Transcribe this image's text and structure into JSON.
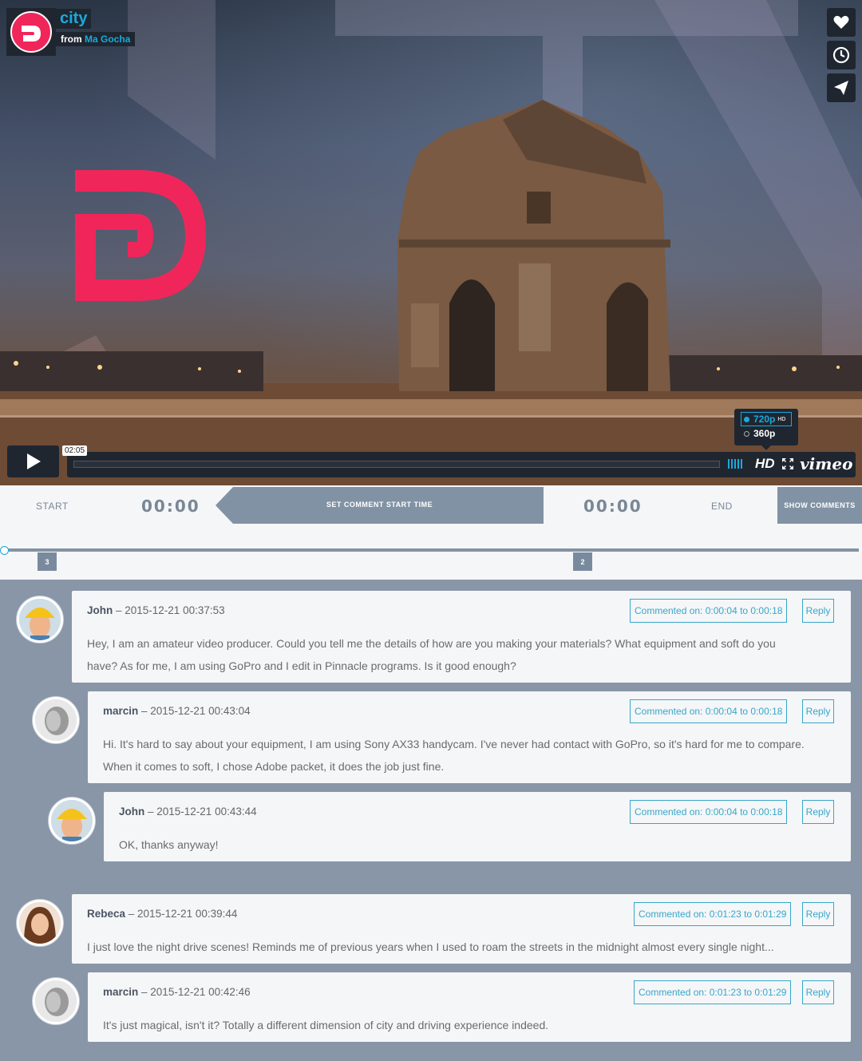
{
  "video": {
    "title": "city",
    "from_label": "from",
    "author": "Ma Gocha",
    "elapsed_time": "02:05",
    "quality_options": [
      {
        "label": "720p",
        "tag": "HD",
        "selected": true
      },
      {
        "label": "360p",
        "tag": "",
        "selected": false
      }
    ],
    "hd_label": "HD",
    "vimeo_label": "vimeo",
    "colors": {
      "brand": "#f0265a",
      "accent": "#1aa9dc"
    }
  },
  "timeline": {
    "start_label": "START",
    "start_time": "00:00",
    "set_button": "SET COMMENT START TIME",
    "end_time": "00:00",
    "end_label": "END",
    "show_comments": "SHOW COMMENTS",
    "markers": [
      "3",
      "2"
    ]
  },
  "comments": [
    {
      "author": "John",
      "date": " – 2015-12-21 00:37:53",
      "range": "Commented on: 0:00:04 to 0:00:18",
      "reply": "Reply",
      "lines": [
        "Hey, I am an amateur video producer. Could you tell me the details of how are you making your materials? What equipment and soft do you",
        "have? As for me, I am using GoPro and I edit in Pinnacle programs. Is it good enough?"
      ],
      "avatar": "worker"
    },
    {
      "author": "marcin",
      "date": " – 2015-12-21 00:43:04",
      "range": "Commented on: 0:00:04 to 0:00:18",
      "reply": "Reply",
      "lines": [
        "Hi. It's hard to say about your equipment, I am using Sony AX33 handycam. I've never had contact with GoPro, so it's hard for me to compare.",
        "When it comes to soft, I chose Adobe packet, it does the job just fine."
      ],
      "avatar": "grey"
    },
    {
      "author": "John",
      "date": " – 2015-12-21 00:43:44",
      "range": "Commented on: 0:00:04 to 0:00:18",
      "reply": "Reply",
      "lines": [
        "OK, thanks anyway!"
      ],
      "avatar": "worker"
    },
    {
      "author": "Rebeca",
      "date": " – 2015-12-21 00:39:44",
      "range": "Commented on: 0:01:23 to 0:01:29",
      "reply": "Reply",
      "lines": [
        "I just love the night drive scenes! Reminds me of previous years when I used to roam the streets in the midnight almost every single night..."
      ],
      "avatar": "woman"
    },
    {
      "author": "marcin",
      "date": " – 2015-12-21 00:42:46",
      "range": "Commented on: 0:01:23 to 0:01:29",
      "reply": "Reply",
      "lines": [
        "It's just magical, isn't it? Totally a different dimension of city and driving experience indeed."
      ],
      "avatar": "grey"
    }
  ]
}
